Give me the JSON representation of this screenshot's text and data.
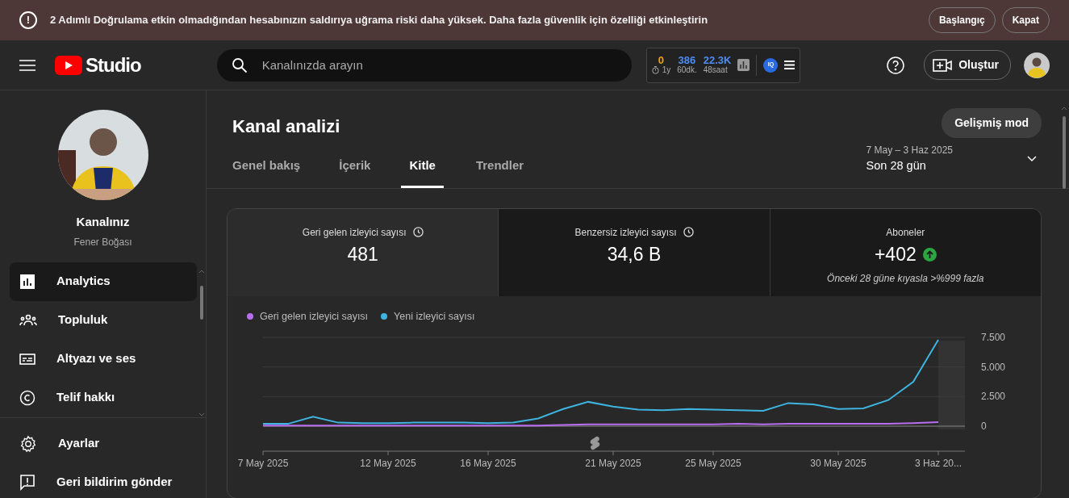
{
  "banner": {
    "icon": "!",
    "message": "2 Adımlı Doğrulama etkin olmadığından hesabınızın saldırıya uğrama riski daha yüksek. Daha fazla güvenlik için özelliği etkinleştirin",
    "buttons": [
      "Başlangıç",
      "Kapat"
    ]
  },
  "header": {
    "logo": "Studio",
    "search": {
      "placeholder": "Kanalınızda arayın"
    },
    "widget": {
      "stats": [
        {
          "value": "0",
          "label": "1y",
          "color": "#f0a010",
          "timer": true
        },
        {
          "value": "386",
          "label": "60dk.",
          "color": "#4e8cf0",
          "timer": false
        },
        {
          "value": "22.3K",
          "label": "48saat",
          "color": "#4e8cf0",
          "timer": false
        }
      ],
      "badge": "IQ"
    },
    "create_button": "Oluştur"
  },
  "sidebar": {
    "channel_title": "Kanalınız",
    "channel_name": "Fener Boğası",
    "items": [
      {
        "label": "Analytics",
        "kind": "chart",
        "selected": true
      },
      {
        "label": "Topluluk",
        "kind": "people",
        "selected": false
      },
      {
        "label": "Altyazı ve ses",
        "kind": "subtitles",
        "selected": false
      },
      {
        "label": "Telif hakkı",
        "kind": "copyright",
        "selected": false
      }
    ],
    "bottom_items": [
      {
        "label": "Ayarlar",
        "kind": "gear"
      },
      {
        "label": "Geri bildirim gönder",
        "kind": "feedback"
      }
    ]
  },
  "main": {
    "title": "Kanal analizi",
    "advanced_button": "Gelişmiş mod",
    "tabs": [
      {
        "label": "Genel bakış",
        "selected": false
      },
      {
        "label": "İçerik",
        "selected": false
      },
      {
        "label": "Kitle",
        "selected": true
      },
      {
        "label": "Trendler",
        "selected": false
      }
    ],
    "date_range": {
      "dates": "7 May – 3 Haz 2025",
      "period": "Son 28 gün"
    },
    "metrics": [
      {
        "label": "Geri gelen izleyici sayısı",
        "value": "481",
        "info": true,
        "selected": true
      },
      {
        "label": "Benzersiz izleyici sayısı",
        "value": "34,6 B",
        "info": true,
        "selected": false
      },
      {
        "label": "Aboneler",
        "value": "+402",
        "info": false,
        "up": true,
        "note": "Önceki 28 güne kıyasla >%999 fazla",
        "selected": false
      }
    ],
    "chart_data": {
      "type": "line",
      "categories": [
        "7 May 2025",
        null,
        null,
        null,
        null,
        "12 May 2025",
        null,
        null,
        null,
        "16 May 2025",
        null,
        null,
        null,
        null,
        "21 May 2025",
        null,
        null,
        null,
        "25 May 2025",
        null,
        null,
        null,
        null,
        "30 May 2025",
        null,
        null,
        null,
        "3 Haz 20..."
      ],
      "series": [
        {
          "name": "Geri gelen izleyici sayısı",
          "color": "#b86ef0",
          "values": [
            0.05,
            0.05,
            0.05,
            0.05,
            0.05,
            0.05,
            0.05,
            0.05,
            0.05,
            0.05,
            0.05,
            0.05,
            0.1,
            0.15,
            0.15,
            0.15,
            0.15,
            0.15,
            0.15,
            0.2,
            0.15,
            0.2,
            0.2,
            0.2,
            0.2,
            0.2,
            0.25,
            0.35
          ]
        },
        {
          "name": "Yeni izleyici sayısı",
          "color": "#3eb4e0",
          "values": [
            0.2,
            0.2,
            0.8,
            0.3,
            0.25,
            0.25,
            0.3,
            0.3,
            0.3,
            0.25,
            0.3,
            0.65,
            1.45,
            2.05,
            1.65,
            1.4,
            1.35,
            1.45,
            1.4,
            1.35,
            1.3,
            1.95,
            1.85,
            1.45,
            1.5,
            2.2,
            3.75,
            7.3
          ]
        }
      ],
      "ylim": [
        0,
        7.5
      ],
      "yticks": [
        {
          "value": 0,
          "label": "0"
        },
        {
          "value": 2.5,
          "label": "2.500"
        },
        {
          "value": 5,
          "label": "5.000"
        },
        {
          "value": 7.5,
          "label": "7.500"
        }
      ]
    }
  }
}
